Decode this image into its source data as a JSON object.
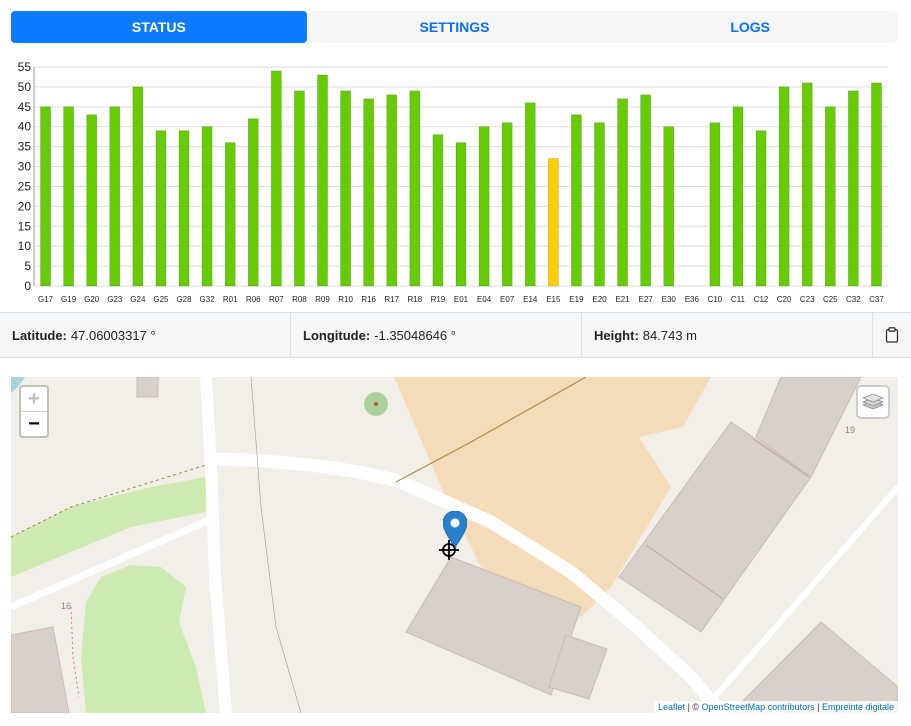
{
  "tabs": [
    {
      "label": "STATUS",
      "active": true
    },
    {
      "label": "SETTINGS",
      "active": false
    },
    {
      "label": "LOGS",
      "active": false
    }
  ],
  "chart_data": {
    "type": "bar",
    "categories": [
      "G17",
      "G19",
      "G20",
      "G23",
      "G24",
      "G25",
      "G28",
      "G32",
      "R01",
      "R06",
      "R07",
      "R08",
      "R09",
      "R10",
      "R16",
      "R17",
      "R18",
      "R19",
      "E01",
      "E04",
      "E07",
      "E14",
      "E15",
      "E19",
      "E20",
      "E21",
      "E27",
      "E30",
      "E36",
      "C10",
      "C11",
      "C12",
      "C20",
      "C23",
      "C25",
      "C32",
      "C37"
    ],
    "values": [
      45,
      45,
      43,
      45,
      50,
      39,
      39,
      40,
      36,
      42,
      54,
      49,
      53,
      49,
      47,
      48,
      49,
      38,
      36,
      40,
      41,
      46,
      32,
      43,
      41,
      47,
      48,
      40,
      0,
      41,
      45,
      39,
      50,
      51,
      45,
      49,
      51
    ],
    "bar_colors": [
      "#66cc00",
      "#66cc00",
      "#66cc00",
      "#66cc00",
      "#66cc00",
      "#66cc00",
      "#66cc00",
      "#66cc00",
      "#66cc00",
      "#66cc00",
      "#66cc00",
      "#66cc00",
      "#66cc00",
      "#66cc00",
      "#66cc00",
      "#66cc00",
      "#66cc00",
      "#66cc00",
      "#66cc00",
      "#66cc00",
      "#66cc00",
      "#66cc00",
      "#ffcc00",
      "#66cc00",
      "#66cc00",
      "#66cc00",
      "#66cc00",
      "#66cc00",
      "#66cc00",
      "#66cc00",
      "#66cc00",
      "#66cc00",
      "#66cc00",
      "#66cc00",
      "#66cc00",
      "#66cc00",
      "#66cc00"
    ],
    "yticks": [
      0,
      5,
      10,
      15,
      20,
      25,
      30,
      35,
      40,
      45,
      50,
      55
    ],
    "ylim": [
      0,
      55
    ],
    "grid": true
  },
  "position": {
    "latitude_label": "Latitude:",
    "latitude_value": "47.06003317 °",
    "longitude_label": "Longitude:",
    "longitude_value": "-1.35048646 °",
    "height_label": "Height:",
    "height_value": "84.743 m"
  },
  "map": {
    "zoom_in": "+",
    "zoom_out": "−",
    "house_numbers": [
      "19",
      "16"
    ],
    "attribution": {
      "leaflet": "Leaflet",
      "sep1": " | © ",
      "osm": "OpenStreetMap contributors",
      "sep2": " | ",
      "footprint": "Empreinte digitale"
    }
  },
  "colors": {
    "accent": "#0d7bff",
    "bar_good": "#66cc00",
    "bar_warn": "#ffcc00",
    "marker": "#2a81cb"
  }
}
